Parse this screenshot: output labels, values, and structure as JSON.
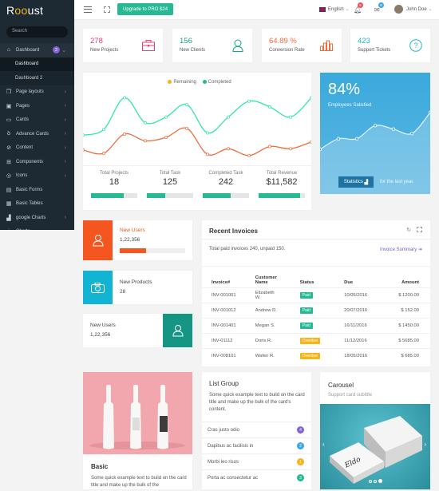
{
  "sidebar": {
    "logo": {
      "pre": "R",
      "mid": "oo",
      "post": "ust"
    },
    "search_placeholder": "Search",
    "dashboard": {
      "label": "Dashboard",
      "badge": "2"
    },
    "sub_items": [
      "Dashboard",
      "Dashboard 2"
    ],
    "items": [
      {
        "label": "Page layouts",
        "icon": "copy-icon",
        "chevron": true
      },
      {
        "label": "Pages",
        "icon": "briefcase-icon",
        "chevron": true
      },
      {
        "label": "Cards",
        "icon": "card-icon",
        "chevron": true
      },
      {
        "label": "Advance Cards",
        "icon": "drop-icon",
        "chevron": true
      },
      {
        "label": "Content",
        "icon": "circle-slash-icon",
        "chevron": true
      },
      {
        "label": "Components",
        "icon": "grid-icon",
        "chevron": true
      },
      {
        "label": "Icons",
        "icon": "eye-icon",
        "chevron": true
      },
      {
        "label": "Basic Forms",
        "icon": "form-icon",
        "chevron": false
      },
      {
        "label": "Basic Tables",
        "icon": "table-icon",
        "chevron": false
      },
      {
        "label": "google Charts",
        "icon": "bar-chart-icon",
        "chevron": true
      },
      {
        "label": "Charts",
        "icon": "line-chart-icon",
        "chevron": true
      }
    ]
  },
  "topbar": {
    "upgrade_label": "Upgrade to PRO $24",
    "language": "English",
    "notifications_count": "5",
    "messages_count": "8",
    "user_name": "John Doe",
    "colors": {
      "notif": "#e8505b",
      "msg": "#3aa9dc"
    }
  },
  "stats": [
    {
      "value": "278",
      "label": "New Projects",
      "color": "#e0407a",
      "icon": "briefcase-icon"
    },
    {
      "value": "156",
      "label": "New Clients",
      "color": "#1aa58a",
      "icon": "user-icon"
    },
    {
      "value": "64.89 %",
      "label": "Conversion Rate",
      "color": "#f06b3e",
      "icon": "bar-chart-icon"
    },
    {
      "value": "423",
      "label": "Support Tickets",
      "color": "#22b8c9",
      "icon": "question-icon"
    }
  ],
  "chart_data": [
    {
      "type": "line",
      "title": "",
      "legend": [
        "Remaining",
        "Completed"
      ],
      "legend_colors": {
        "Remaining": "#f4b41a",
        "Completed": "#26b993"
      },
      "legend_position": "top-center",
      "x": [
        1,
        2,
        3,
        4,
        5,
        6,
        7,
        8,
        9,
        10,
        11,
        12
      ],
      "series": [
        {
          "name": "Completed",
          "color": "#2ee6b0",
          "values": [
            55,
            60,
            88,
            66,
            71,
            82,
            57,
            71,
            85,
            80,
            71,
            88
          ]
        },
        {
          "name": "Remaining",
          "color": "#f06b3e",
          "values": [
            42,
            39,
            56,
            50,
            53,
            61,
            38,
            43,
            37,
            45,
            43,
            49
          ]
        }
      ],
      "ylim": [
        0,
        100
      ],
      "grid": false
    },
    {
      "type": "area",
      "title": "Employees Satisfied",
      "x": [
        1,
        2,
        3,
        4,
        5,
        6,
        7
      ],
      "series": [
        {
          "name": "Satisfaction",
          "values": [
            40,
            52,
            52,
            67,
            63,
            58,
            82
          ]
        }
      ],
      "ylim": [
        0,
        100
      ],
      "grid": false
    }
  ],
  "kpis": [
    {
      "title": "Total Projects",
      "value": "18",
      "progress": 0.7
    },
    {
      "title": "Total Task",
      "value": "125",
      "progress": 0.4
    },
    {
      "title": "Completed Task",
      "value": "242",
      "progress": 0.6
    },
    {
      "title": "Total Revenue",
      "value": "$11,582",
      "progress": 0.9
    }
  ],
  "satisfaction": {
    "percent": "84%",
    "label": "Employees Satisfied",
    "button": "Statistics",
    "note": "for the last year."
  },
  "mini_cards": [
    {
      "title": "New Users",
      "value": "1,22,356",
      "progress": 0.4,
      "color": "#f5561f",
      "icon": "user-icon"
    },
    {
      "title": "New Products",
      "value": "28",
      "color": "#12b4d3",
      "icon": "camera-icon"
    },
    {
      "title": "New Users",
      "value": "1,22,356",
      "color": "#159684",
      "icon": "user-icon"
    }
  ],
  "invoices": {
    "title": "Recent Invoices",
    "summary": "Total paid invoices 240, unpaid 150.",
    "summary_link": "Invoice Summary",
    "columns": [
      "Invoice#",
      "Customer Name",
      "Status",
      "Due",
      "Amount"
    ],
    "rows": [
      {
        "id": "INV-001001",
        "name": "Elizabeth W.",
        "status": "Paid",
        "due": "10/05/2016",
        "amount": "$ 1200.00"
      },
      {
        "id": "INV-001012",
        "name": "Andrew D.",
        "status": "Paid",
        "due": "20/07/2016",
        "amount": "$ 152.00"
      },
      {
        "id": "INV-001401",
        "name": "Megan S.",
        "status": "Paid",
        "due": "16/11/2016",
        "amount": "$ 1450.00"
      },
      {
        "id": "INV-01112",
        "name": "Doris R.",
        "status": "Overdue",
        "due": "11/12/2016",
        "amount": "$ 5685.00"
      },
      {
        "id": "INV-008101",
        "name": "Walter R.",
        "status": "Overdue",
        "due": "18/05/2016",
        "amount": "$ 685.00"
      }
    ],
    "status_colors": {
      "Paid": "#26b993",
      "Overdue": "#f4b41a"
    }
  },
  "basic_card": {
    "title": "Basic",
    "text": "Some quick example text to build on the card title and make up the bulk of the"
  },
  "list_group": {
    "title": "List Group",
    "text": "Some quick example text to build on the card title and make up the bulk of the card's content.",
    "items": [
      {
        "label": "Cras justo odio",
        "badge": "4",
        "color": "#8063d6"
      },
      {
        "label": "Dapibus ac facilisis in",
        "badge": "2",
        "color": "#3aa9dc"
      },
      {
        "label": "Morbi leo risus",
        "badge": "1",
        "color": "#f4b41a"
      },
      {
        "label": "Porta ac consectetur ac",
        "badge": "3",
        "color": "#26b993"
      }
    ]
  },
  "carousel": {
    "title": "Carousel",
    "subtitle": "Support card subtitle",
    "slides": 3,
    "active_slide": 3
  }
}
